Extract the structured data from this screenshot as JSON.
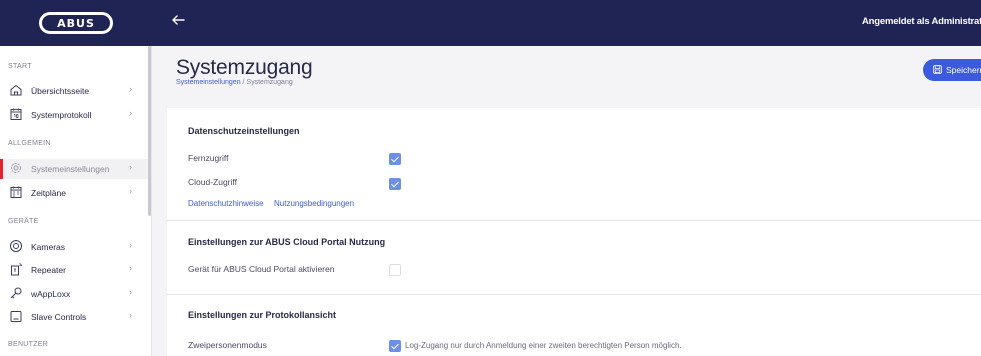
{
  "brand": {
    "logo_text": "ABUS"
  },
  "topbar": {
    "user_status": "Angemeldet als Administrator"
  },
  "sidebar": {
    "sections": [
      {
        "label": "START"
      },
      {
        "label": "ALLGEMEIN"
      },
      {
        "label": "GERÄTE"
      },
      {
        "label": "BENUTZER"
      }
    ],
    "items": [
      {
        "label": "Übersichtsseite",
        "icon": "home-icon"
      },
      {
        "label": "Systemprotokoll",
        "icon": "calendar-log-icon"
      },
      {
        "label": "Systemeinstellungen",
        "icon": "gear-icon",
        "active": true
      },
      {
        "label": "Zeitpläne",
        "icon": "schedule-icon"
      },
      {
        "label": "Kameras",
        "icon": "camera-icon"
      },
      {
        "label": "Repeater",
        "icon": "repeater-icon"
      },
      {
        "label": "wAppLoxx",
        "icon": "key-icon"
      },
      {
        "label": "Slave Controls",
        "icon": "slave-control-icon"
      }
    ]
  },
  "header": {
    "title": "Systemzugang",
    "breadcrumb": {
      "parent": "Systemeinstellungen",
      "separator": " / ",
      "current": "Systemzugang"
    },
    "save_label": "Speichern"
  },
  "settings": {
    "privacy": {
      "title": "Datenschutzeinstellungen",
      "remote_access": {
        "label": "Fernzugriff",
        "checked": true
      },
      "cloud_access": {
        "label": "Cloud-Zugriff",
        "checked": true
      },
      "privacy_link": "Datenschutzhinweise",
      "terms_link": "Nutzungsbedingungen"
    },
    "cloud_portal": {
      "title": "Einstellungen zur ABUS Cloud Portal Nutzung",
      "activate": {
        "label": "Gerät für ABUS Cloud Portal aktivieren",
        "checked": false
      }
    },
    "log_view": {
      "title": "Einstellungen zur Protokollansicht",
      "two_person": {
        "label": "Zweipersonenmodus",
        "checked": true,
        "description": "Log-Zugang nur durch Anmeldung einer zweiten berechtigten Person möglich."
      }
    }
  },
  "colors": {
    "topbar": "#1f2455",
    "accent": "#3b5bdc",
    "active_marker": "#e0262d"
  }
}
